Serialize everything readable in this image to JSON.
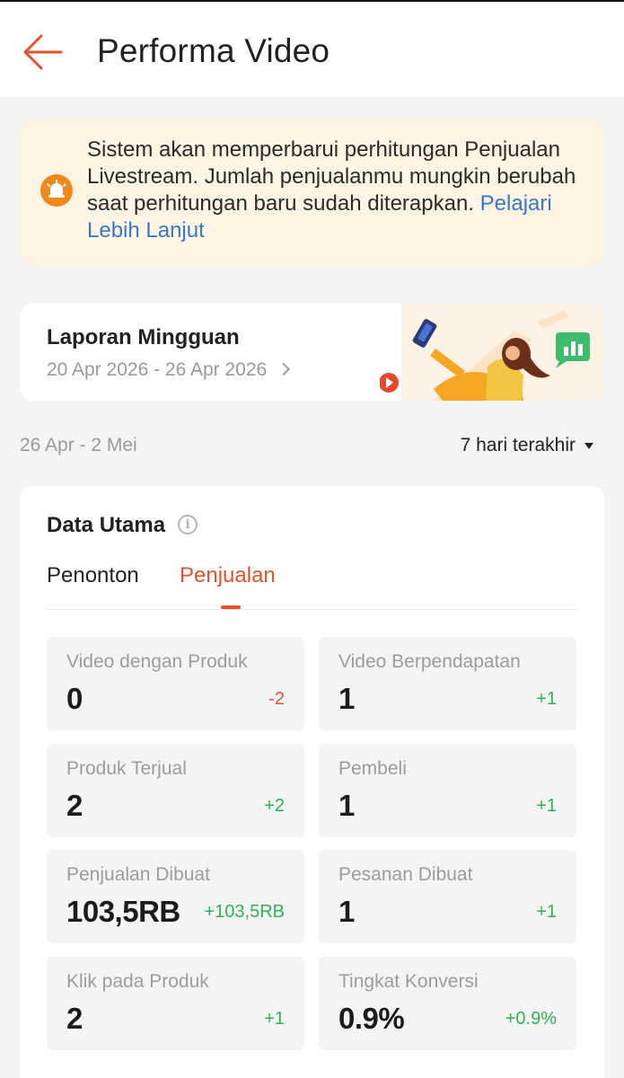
{
  "header": {
    "title": "Performa Video"
  },
  "notice": {
    "text": "Sistem akan memperbarui perhitungan Penjualan Livestream. Jumlah penjualanmu mungkin berubah saat perhitungan baru sudah diterapkan.",
    "link": "Pelajari Lebih Lanjut"
  },
  "weekly_report": {
    "title": "Laporan Mingguan",
    "range": "20 Apr 2026 - 26 Apr 2026"
  },
  "filter": {
    "range": "26 Apr - 2 Mei",
    "period": "7 hari terakhir"
  },
  "main": {
    "title": "Data Utama",
    "tabs": [
      {
        "label": "Penonton",
        "active": false
      },
      {
        "label": "Penjualan",
        "active": true
      }
    ],
    "metrics": [
      {
        "label": "Video dengan Produk",
        "value": "0",
        "delta": "-2"
      },
      {
        "label": "Video Berpendapatan",
        "value": "1",
        "delta": "+1"
      },
      {
        "label": "Produk Terjual",
        "value": "2",
        "delta": "+2"
      },
      {
        "label": "Pembeli",
        "value": "1",
        "delta": "+1"
      },
      {
        "label": "Penjualan Dibuat",
        "value": "103,5RB",
        "delta": "+103,5RB"
      },
      {
        "label": "Pesanan Dibuat",
        "value": "1",
        "delta": "+1"
      },
      {
        "label": "Klik pada Produk",
        "value": "2",
        "delta": "+1"
      },
      {
        "label": "Tingkat Konversi",
        "value": "0.9%",
        "delta": "+0.9%"
      }
    ]
  },
  "colors": {
    "accent": "#e2522c",
    "positive": "#2fb256",
    "negative": "#e4503a",
    "link": "#3a77cc",
    "notice_bg": "#fdf4e3"
  }
}
